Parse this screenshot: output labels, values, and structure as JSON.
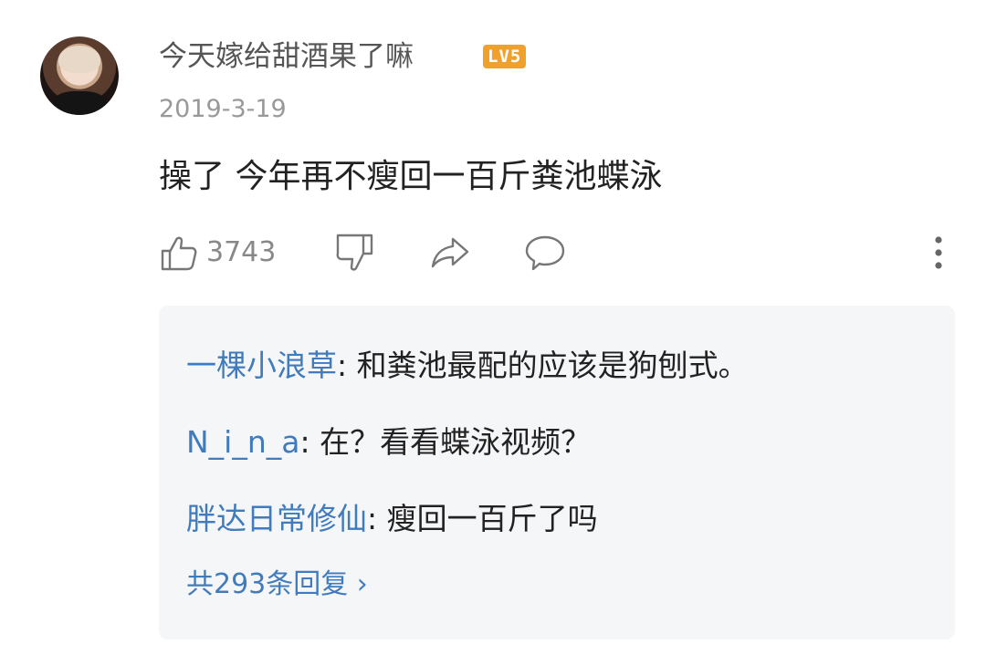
{
  "comment": {
    "username": "今天嫁给甜酒果了嘛",
    "level_badge": "LV5",
    "date": "2019-3-19",
    "text": "操了 今年再不瘦回一百斤粪池蝶泳",
    "like_count": "3743"
  },
  "actions": {
    "like_icon": "thumbs-up-icon",
    "dislike_icon": "thumbs-down-icon",
    "share_icon": "share-arrow-icon",
    "reply_icon": "speech-bubble-icon",
    "more_icon": "vertical-dots-icon"
  },
  "replies": {
    "items": [
      {
        "user": "一棵小浪草",
        "separator": ": ",
        "text": "和粪池最配的应该是狗刨式。"
      },
      {
        "user": "N_i_n_a",
        "separator": ": ",
        "text": "在？看看蝶泳视频？"
      },
      {
        "user": "胖达日常修仙",
        "separator": ": ",
        "text": "瘦回一百斤了吗"
      }
    ],
    "more_label": "共293条回复 ›"
  },
  "colors": {
    "link_blue": "#3f7bbd",
    "badge_orange": "#f0a12b",
    "replies_bg": "#f5f6f8",
    "secondary_text": "#999999"
  }
}
